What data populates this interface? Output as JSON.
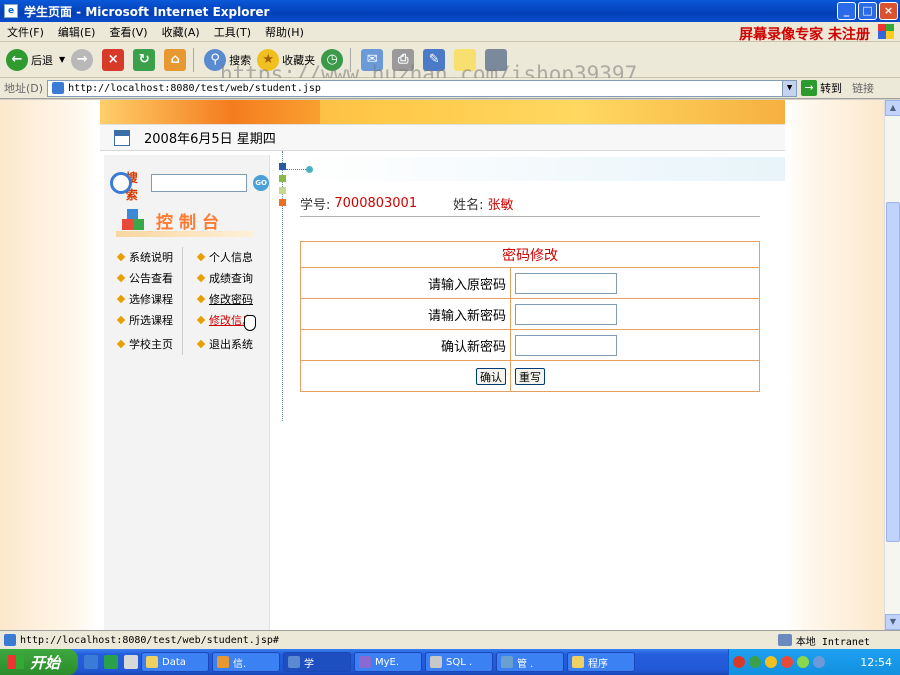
{
  "window": {
    "title": "学生页面 - Microsoft Internet Explorer",
    "recorder_watermark": "屏幕录像专家 未注册"
  },
  "menubar": {
    "items": [
      "文件(F)",
      "编辑(E)",
      "查看(V)",
      "收藏(A)",
      "工具(T)",
      "帮助(H)"
    ]
  },
  "toolbar": {
    "back_label": "后退",
    "search_label": "搜索",
    "favorites_label": "收藏夹",
    "url_watermark": "https://www.huzhan.com/ishop39397"
  },
  "addressbar": {
    "label": "地址(D)",
    "url": "http://localhost:8080/test/web/student.jsp",
    "go_label": "转到",
    "links_label": "链接"
  },
  "page": {
    "date_text": "2008年6月5日  星期四",
    "search": {
      "label": "搜索",
      "placeholder": "",
      "go_label": "GO"
    },
    "console_title": "控制台",
    "nav_left": [
      "系统说明",
      "公告查看",
      "选修课程",
      "所选课程",
      "学校主页"
    ],
    "nav_right": [
      "个人信息",
      "成绩查询",
      "修改密码",
      "修改信息",
      "退出系统"
    ],
    "student": {
      "id_label": "学号:",
      "id_value": "7000803001",
      "name_label": "姓名:",
      "name_value": "张敏"
    },
    "password_form": {
      "title": "密码修改",
      "old_label": "请输入原密码",
      "new_label": "请输入新密码",
      "confirm_label": "确认新密码",
      "confirm_button": "确认",
      "reset_button": "重写"
    }
  },
  "statusbar": {
    "text": "http://localhost:8080/test/web/student.jsp#",
    "zone": "本地 Intranet"
  },
  "taskbar": {
    "start_label": "开始",
    "tasks": [
      "Data",
      "信.",
      "学",
      "MyE.",
      "SQL .",
      "管 .",
      "程序"
    ],
    "clock": "12:54"
  },
  "colors": {
    "title_bar": "#0a4ccc",
    "accent_red": "#d00000",
    "table_border": "#e8a060"
  }
}
